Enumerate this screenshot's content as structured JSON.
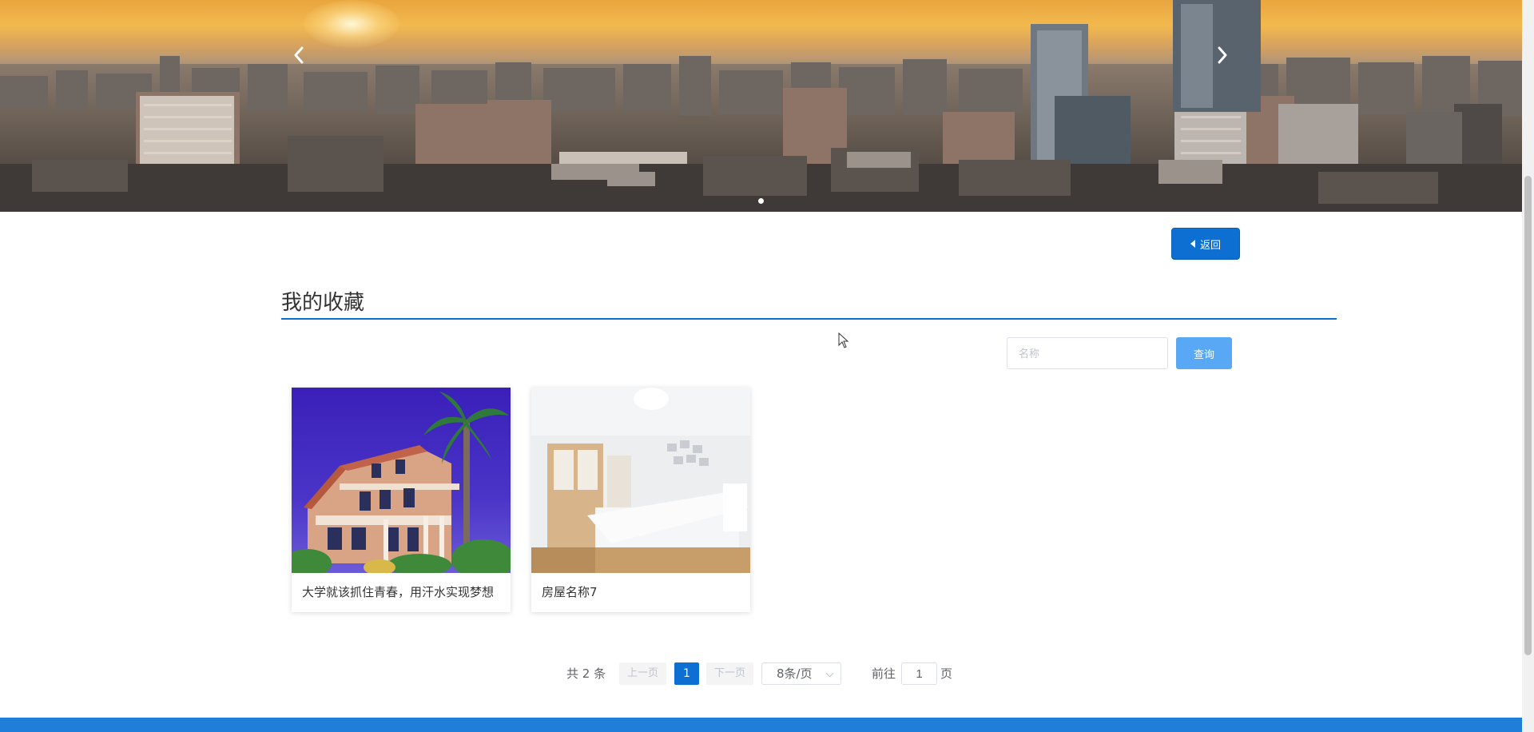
{
  "banner": {
    "prev_icon": "chevron-left-icon",
    "next_icon": "chevron-right-icon",
    "dots": 1
  },
  "back_button": {
    "label": "返回",
    "icon": "caret-left-icon"
  },
  "section": {
    "title": "我的收藏"
  },
  "search": {
    "placeholder": "名称",
    "value": "",
    "button_label": "查询"
  },
  "cards": [
    {
      "caption": "大学就该抓住青春，用汗水实现梦想",
      "image": "villa-photo"
    },
    {
      "caption": "房屋名称7",
      "image": "bedroom-photo"
    }
  ],
  "pagination": {
    "total_text": "共 2 条",
    "prev_label": "上一页",
    "next_label": "下一页",
    "current_page": "1",
    "page_size_label": "8条/页",
    "goto_label": "前往",
    "goto_value": "1",
    "page_suffix": "页"
  },
  "colors": {
    "primary": "#0d6fd1",
    "search_button": "#58a8f5",
    "footer": "#1f7fd8"
  }
}
